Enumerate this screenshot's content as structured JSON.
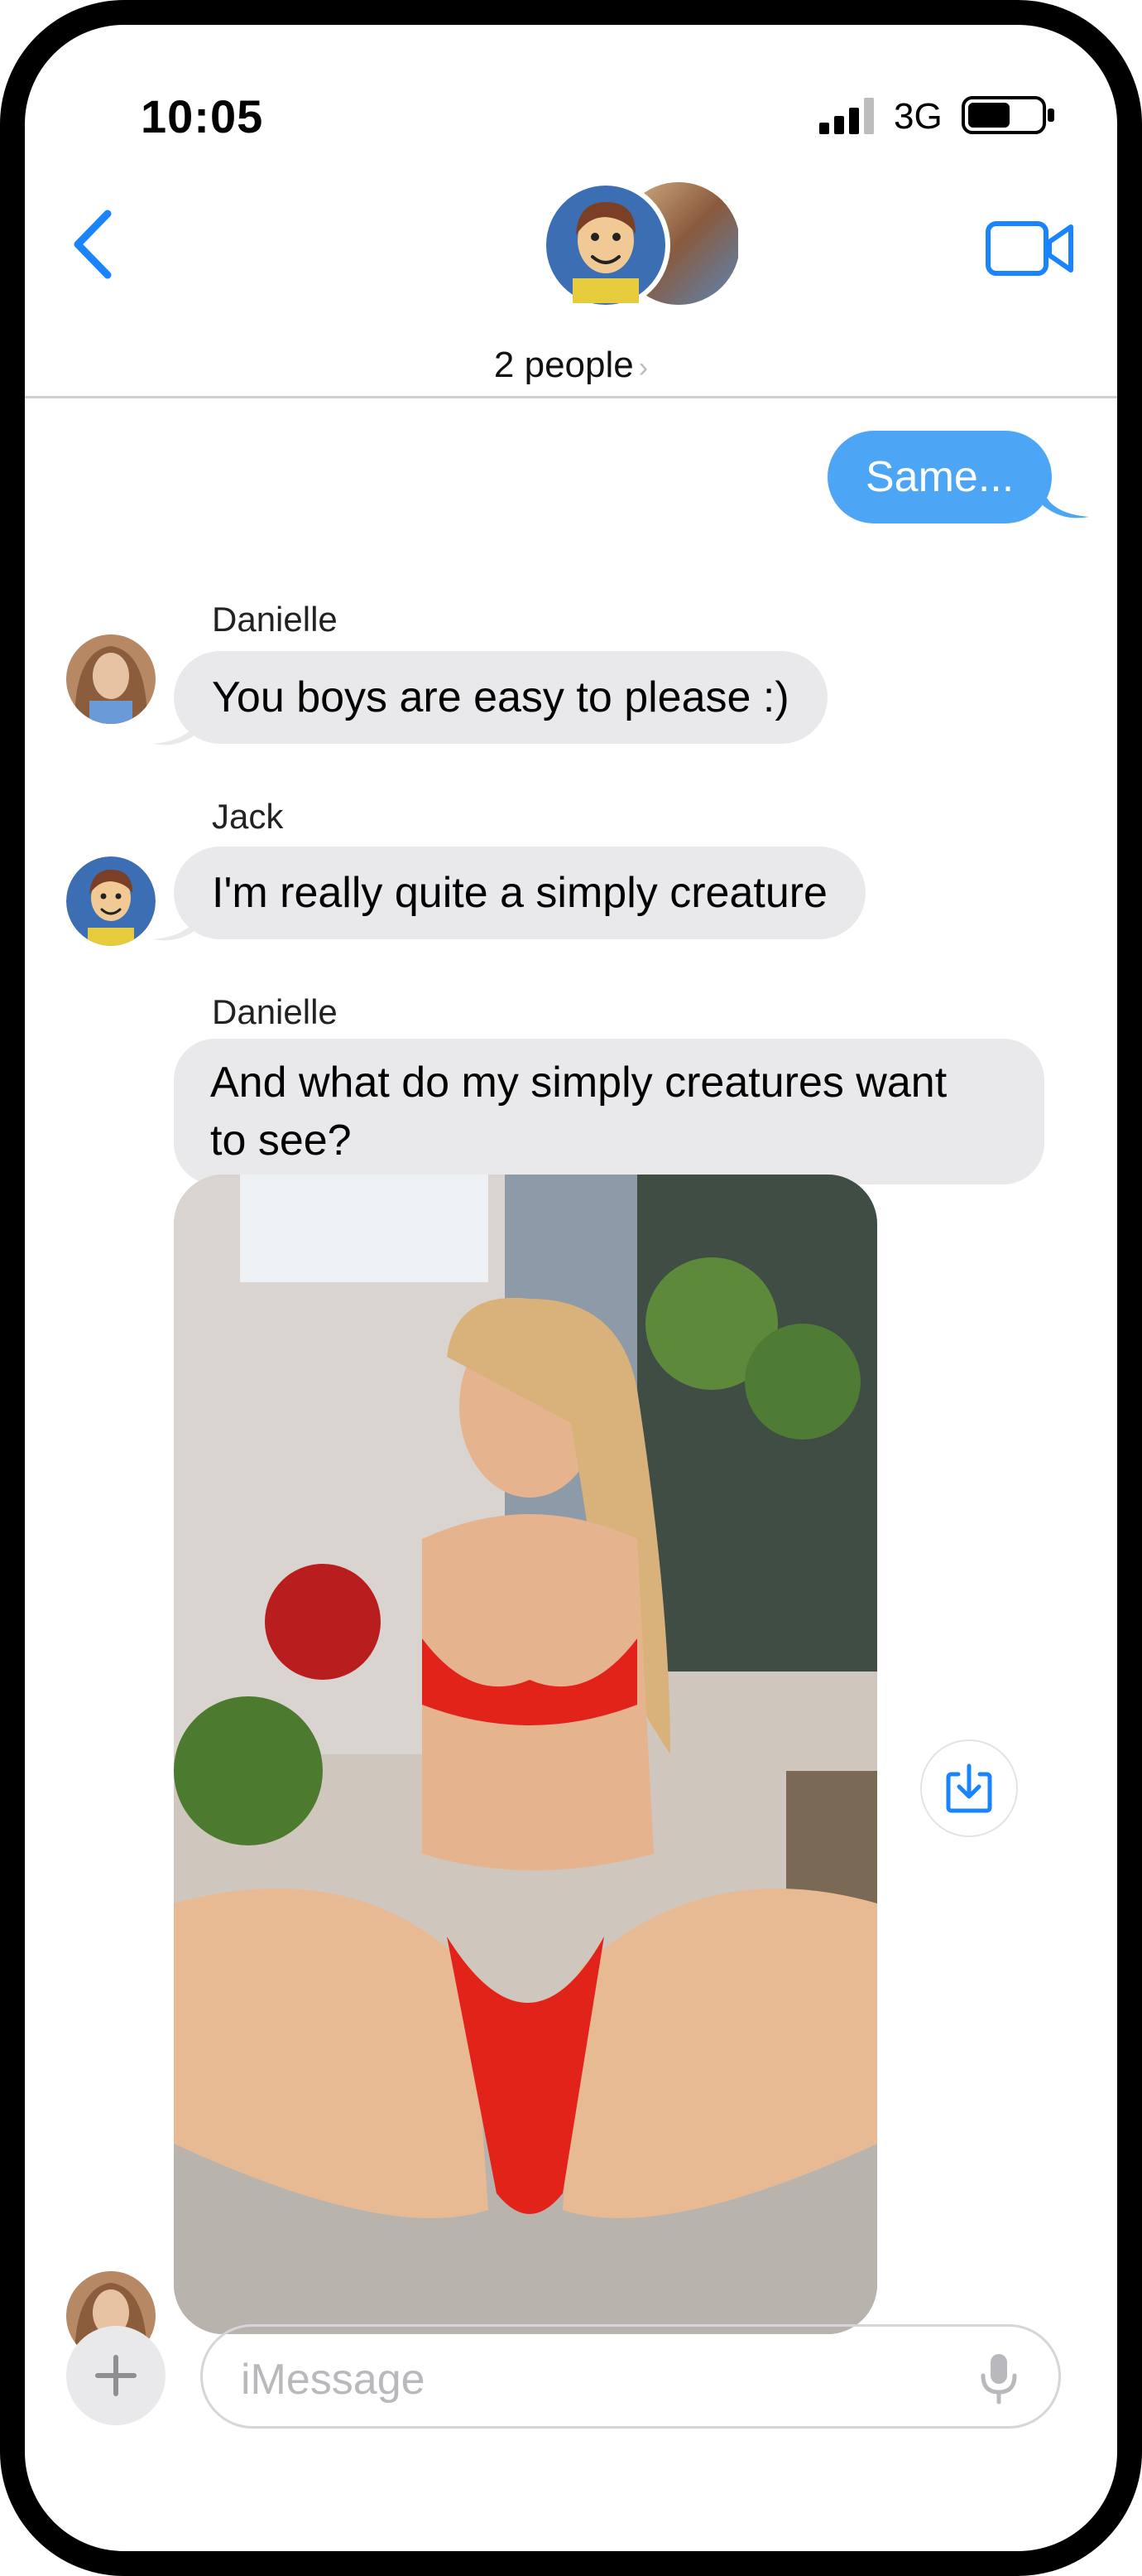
{
  "status_bar": {
    "time": "10:05",
    "network": "3G"
  },
  "header": {
    "title": "2 people",
    "chevron": "›"
  },
  "messages": [
    {
      "direction": "outgoing",
      "text": "Same..."
    },
    {
      "direction": "incoming",
      "sender": "Danielle",
      "text": "You boys are easy to please :)"
    },
    {
      "direction": "incoming",
      "sender": "Jack",
      "text": "I'm really quite a simply creature"
    },
    {
      "direction": "incoming",
      "sender": "Danielle",
      "text_line1": "And what do my simply creatures want",
      "text_line2": "to see?"
    }
  ],
  "composer": {
    "placeholder": "iMessage"
  },
  "icons": {
    "back": "chevron-left-icon",
    "video": "video-camera-icon",
    "save": "download-icon",
    "plus": "plus-icon",
    "mic": "microphone-icon"
  },
  "colors": {
    "accent": "#1a84ff",
    "outgoing_bubble": "#4da6f5",
    "incoming_bubble": "#e9e9eb"
  }
}
